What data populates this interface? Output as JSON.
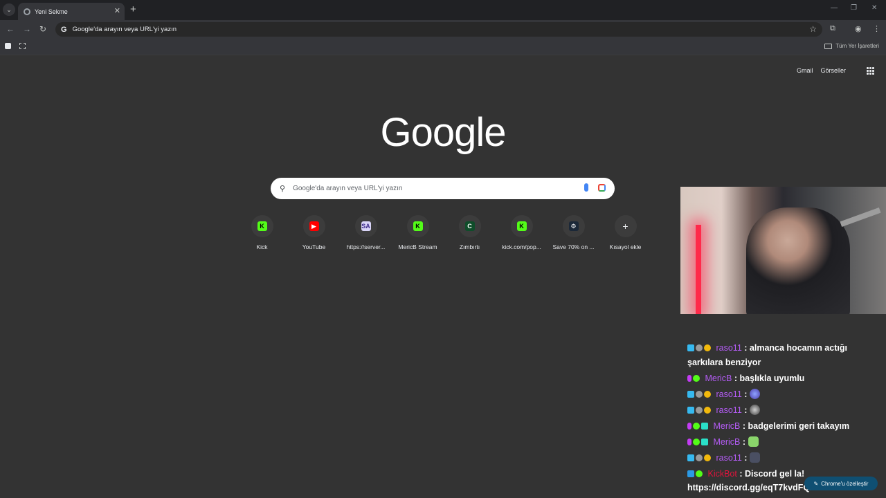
{
  "tab": {
    "title": "Yeni Sekme",
    "close": "✕",
    "new_tab": "+"
  },
  "window": {
    "minimize": "—",
    "restore": "❐",
    "close": "✕"
  },
  "toolbar": {
    "back": "←",
    "forward": "→",
    "reload": "↻",
    "omnibox_text": "Google'da arayın veya URL'yi yazın",
    "omnibox_icon": "G",
    "star": "☆",
    "extensions": "⧉",
    "profile": "◉",
    "menu": "⋮"
  },
  "bookmarks": {
    "all_bookmarks": "Tüm Yer İşaretleri"
  },
  "top_links": {
    "gmail": "Gmail",
    "images": "Görseller"
  },
  "logo": "Google",
  "search": {
    "placeholder": "Google'da arayın veya URL'yi yazın",
    "icon": "⚲"
  },
  "shortcuts": [
    {
      "label": "Kick",
      "glyph": "K",
      "color": "#53fc18",
      "text_color": "#000000"
    },
    {
      "label": "YouTube",
      "glyph": "▶",
      "color": "#ff0000",
      "text_color": "#ffffff"
    },
    {
      "label": "https://server...",
      "glyph": "SA",
      "color": "#d9d4f7",
      "text_color": "#3d2a8a"
    },
    {
      "label": "MericB Stream",
      "glyph": "K",
      "color": "#53fc18",
      "text_color": "#000000"
    },
    {
      "label": "Zımbırtı",
      "glyph": "C",
      "color": "#0f4d2a",
      "text_color": "#ffffff"
    },
    {
      "label": "kick.com/pop...",
      "glyph": "K",
      "color": "#53fc18",
      "text_color": "#000000"
    },
    {
      "label": "Save 70% on ...",
      "glyph": "⚙",
      "color": "#1b2838",
      "text_color": "#ffffff"
    },
    {
      "label": "Kısayol ekle",
      "glyph": "+",
      "color": "transparent",
      "text_color": "#e8eaed"
    }
  ],
  "chat": [
    {
      "user": "raso11",
      "sep": ":",
      "text": "almanca hocamın actığı şarkılara benziyor"
    },
    {
      "user": "MericB",
      "sep": ":",
      "text": "başlıkla uyumlu"
    },
    {
      "user": "raso11",
      "sep": ":",
      "text": ""
    },
    {
      "user": "raso11",
      "sep": ":",
      "text": ""
    },
    {
      "user": "MericB",
      "sep": ":",
      "text": "badgelerimi geri takayım"
    },
    {
      "user": "MericB",
      "sep": ":",
      "text": ""
    },
    {
      "user": "raso11",
      "sep": ":",
      "text": ""
    },
    {
      "user": "KickBot",
      "sep": ":",
      "text": "Discord gel la!",
      "text2": "https://discord.gg/eqT7kvdFQX"
    }
  ],
  "customize_chrome": "Chrome'u özelleştir",
  "customize_icon": "✎"
}
